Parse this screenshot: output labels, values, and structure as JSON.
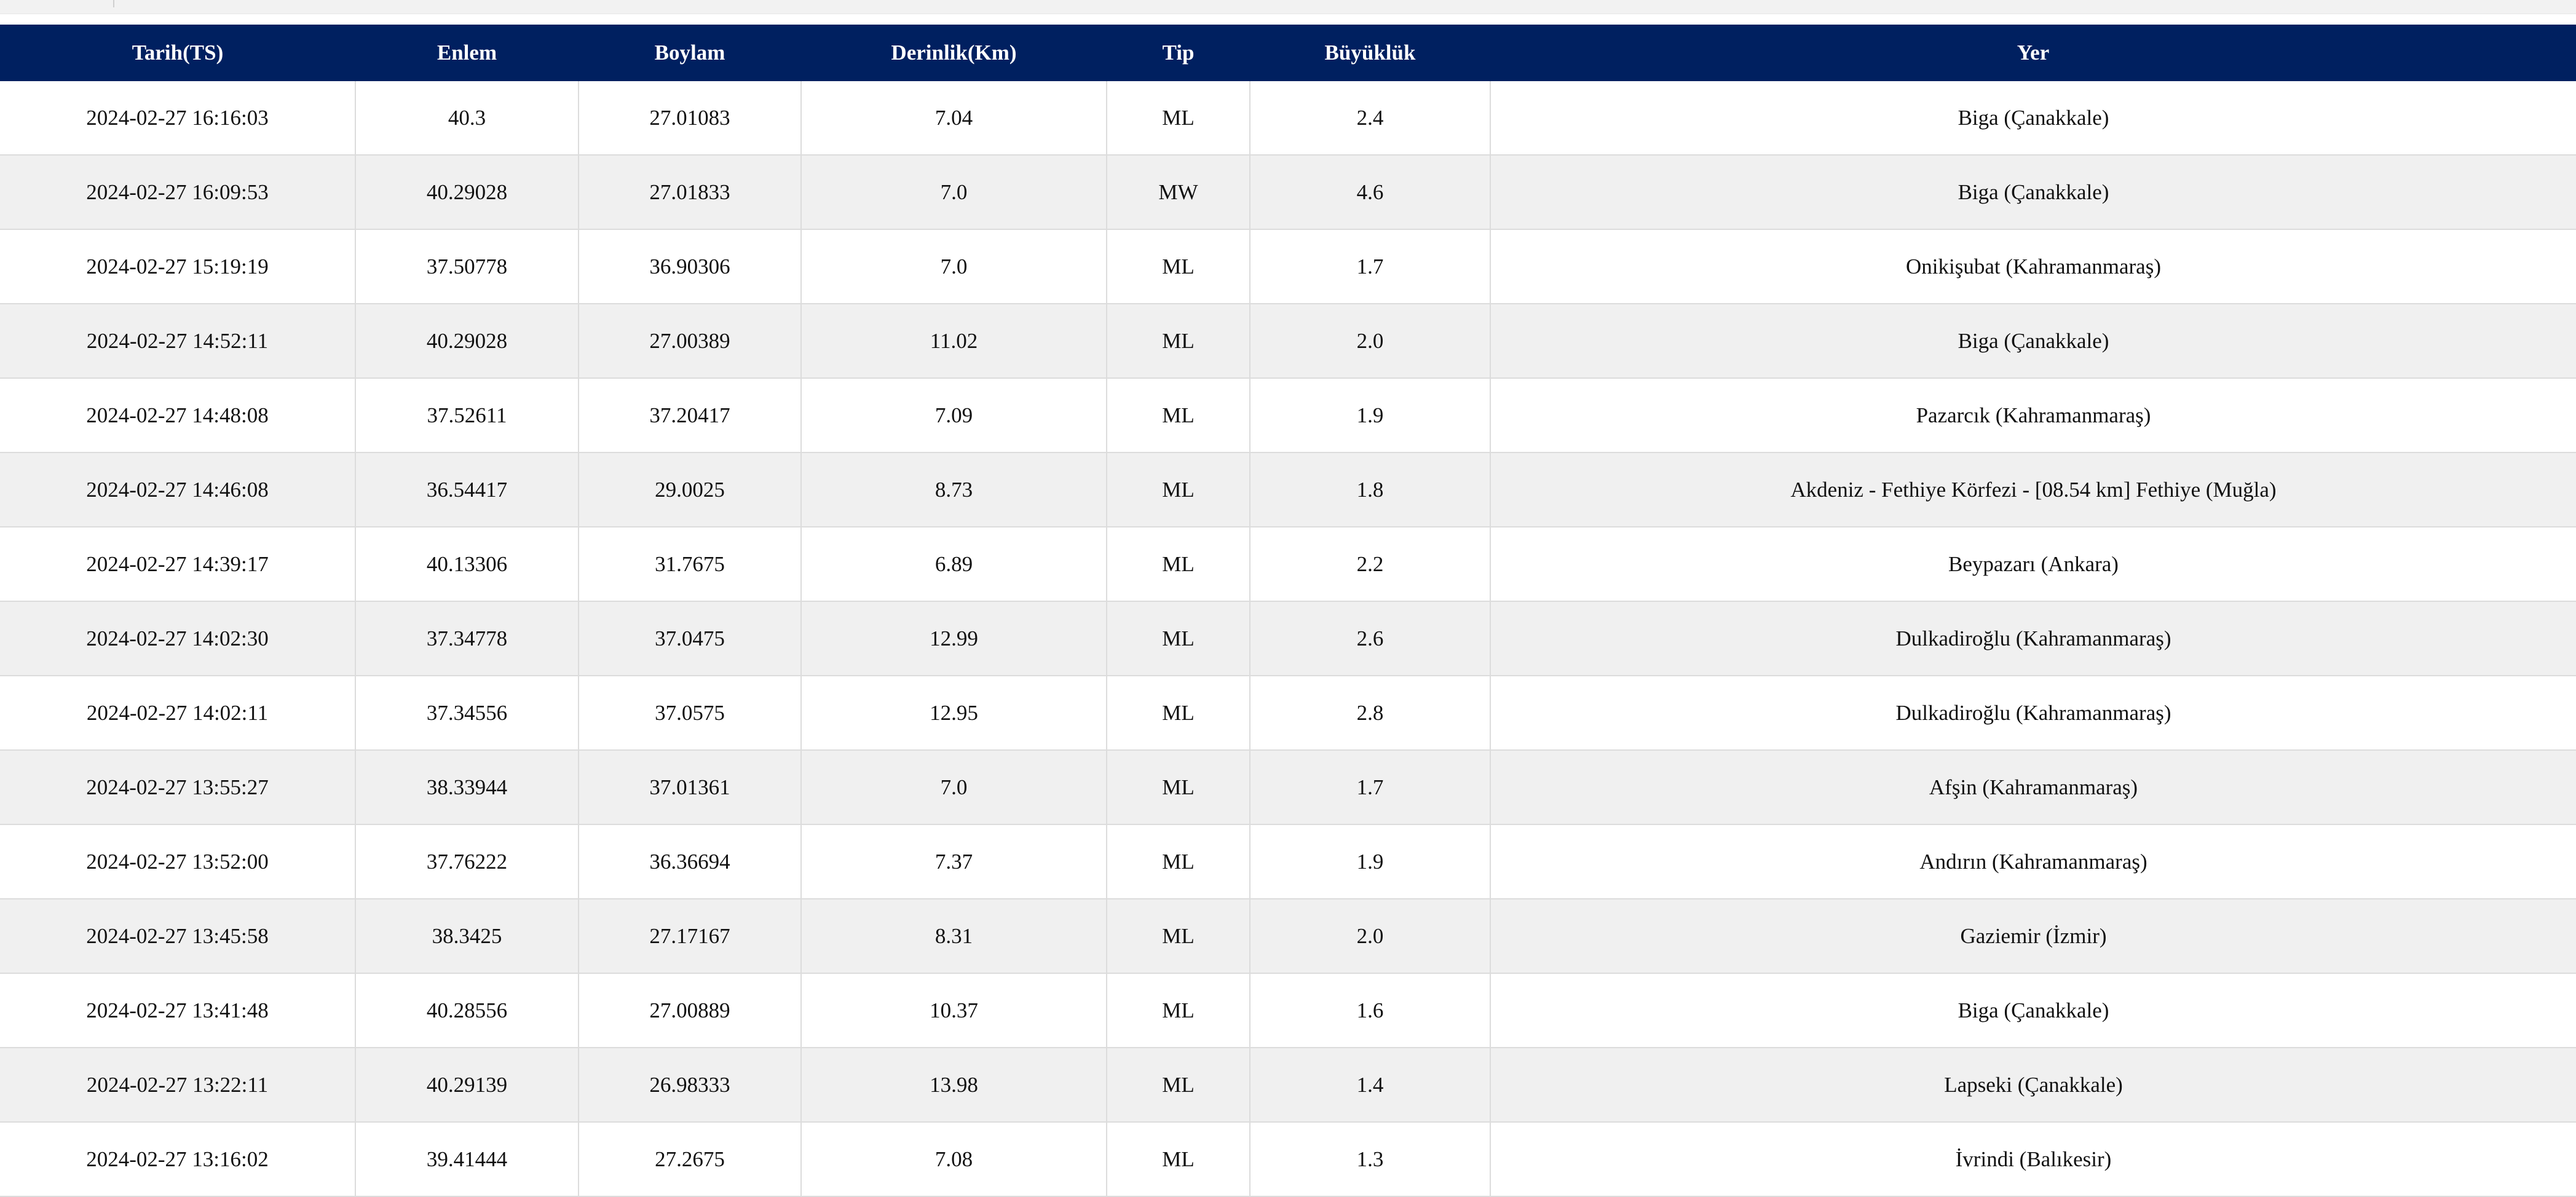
{
  "table": {
    "headers": [
      "Tarih(TS)",
      "Enlem",
      "Boylam",
      "Derinlik(Km)",
      "Tip",
      "Büyüklük",
      "Yer"
    ],
    "rows": [
      [
        "2024-02-27 16:16:03",
        "40.3",
        "27.01083",
        "7.04",
        "ML",
        "2.4",
        "Biga (Çanakkale)"
      ],
      [
        "2024-02-27 16:09:53",
        "40.29028",
        "27.01833",
        "7.0",
        "MW",
        "4.6",
        "Biga (Çanakkale)"
      ],
      [
        "2024-02-27 15:19:19",
        "37.50778",
        "36.90306",
        "7.0",
        "ML",
        "1.7",
        "Onikişubat (Kahramanmaraş)"
      ],
      [
        "2024-02-27 14:52:11",
        "40.29028",
        "27.00389",
        "11.02",
        "ML",
        "2.0",
        "Biga (Çanakkale)"
      ],
      [
        "2024-02-27 14:48:08",
        "37.52611",
        "37.20417",
        "7.09",
        "ML",
        "1.9",
        "Pazarcık (Kahramanmaraş)"
      ],
      [
        "2024-02-27 14:46:08",
        "36.54417",
        "29.0025",
        "8.73",
        "ML",
        "1.8",
        "Akdeniz - Fethiye Körfezi - [08.54 km] Fethiye (Muğla)"
      ],
      [
        "2024-02-27 14:39:17",
        "40.13306",
        "31.7675",
        "6.89",
        "ML",
        "2.2",
        "Beypazarı (Ankara)"
      ],
      [
        "2024-02-27 14:02:30",
        "37.34778",
        "37.0475",
        "12.99",
        "ML",
        "2.6",
        "Dulkadiroğlu (Kahramanmaraş)"
      ],
      [
        "2024-02-27 14:02:11",
        "37.34556",
        "37.0575",
        "12.95",
        "ML",
        "2.8",
        "Dulkadiroğlu (Kahramanmaraş)"
      ],
      [
        "2024-02-27 13:55:27",
        "38.33944",
        "37.01361",
        "7.0",
        "ML",
        "1.7",
        "Afşin (Kahramanmaraş)"
      ],
      [
        "2024-02-27 13:52:00",
        "37.76222",
        "36.36694",
        "7.37",
        "ML",
        "1.9",
        "Andırın (Kahramanmaraş)"
      ],
      [
        "2024-02-27 13:45:58",
        "38.3425",
        "27.17167",
        "8.31",
        "ML",
        "2.0",
        "Gaziemir (İzmir)"
      ],
      [
        "2024-02-27 13:41:48",
        "40.28556",
        "27.00889",
        "10.37",
        "ML",
        "1.6",
        "Biga (Çanakkale)"
      ],
      [
        "2024-02-27 13:22:11",
        "40.29139",
        "26.98333",
        "13.98",
        "ML",
        "1.4",
        "Lapseki (Çanakkale)"
      ],
      [
        "2024-02-27 13:16:02",
        "39.41444",
        "27.2675",
        "7.08",
        "ML",
        "1.3",
        "İvrindi (Balıkesir)"
      ]
    ]
  },
  "colors": {
    "header_bg": "#002060",
    "header_text": "#ffffff",
    "row_alt_bg": "#f0f0f0",
    "grid_line": "#dcdcdc"
  }
}
